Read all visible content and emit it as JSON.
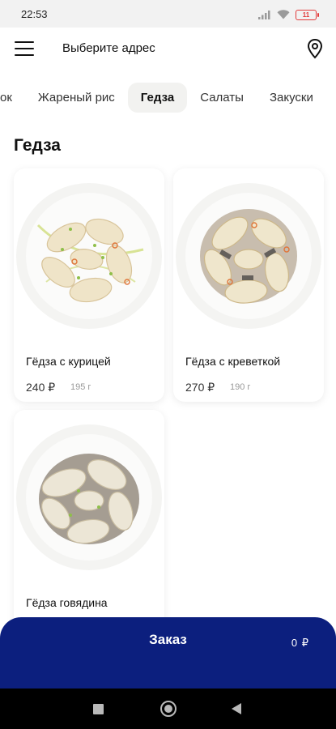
{
  "status_bar": {
    "time": "22:53",
    "battery": "11",
    "icons": [
      "signal-icon",
      "wifi-icon",
      "battery-icon"
    ]
  },
  "header": {
    "address_placeholder": "Выберите адрес",
    "icons": [
      "menu-icon",
      "location-pin-icon"
    ]
  },
  "tabs": [
    {
      "label": "ок",
      "active": false
    },
    {
      "label": "Жареный рис",
      "active": false
    },
    {
      "label": "Гедза",
      "active": true
    },
    {
      "label": "Салаты",
      "active": false
    },
    {
      "label": "Закуски",
      "active": false
    }
  ],
  "section": {
    "title": "Гедза"
  },
  "products": [
    {
      "name": "Гёдза с курицей",
      "price": "240 ₽",
      "weight": "195 г"
    },
    {
      "name": "Гёдза с креветкой",
      "price": "270 ₽",
      "weight": "190 г"
    },
    {
      "name": "Гёдза говядина",
      "price": "",
      "weight": ""
    }
  ],
  "order_bar": {
    "label": "Заказ",
    "total": "0 ₽"
  },
  "nav_bar": {
    "icons": [
      "recent-apps-icon",
      "home-icon",
      "back-icon"
    ]
  },
  "colors": {
    "order_bar": "#0c1f7e",
    "active_tab_bg": "#f2f2f0",
    "battery_low": "#e23b3b"
  }
}
